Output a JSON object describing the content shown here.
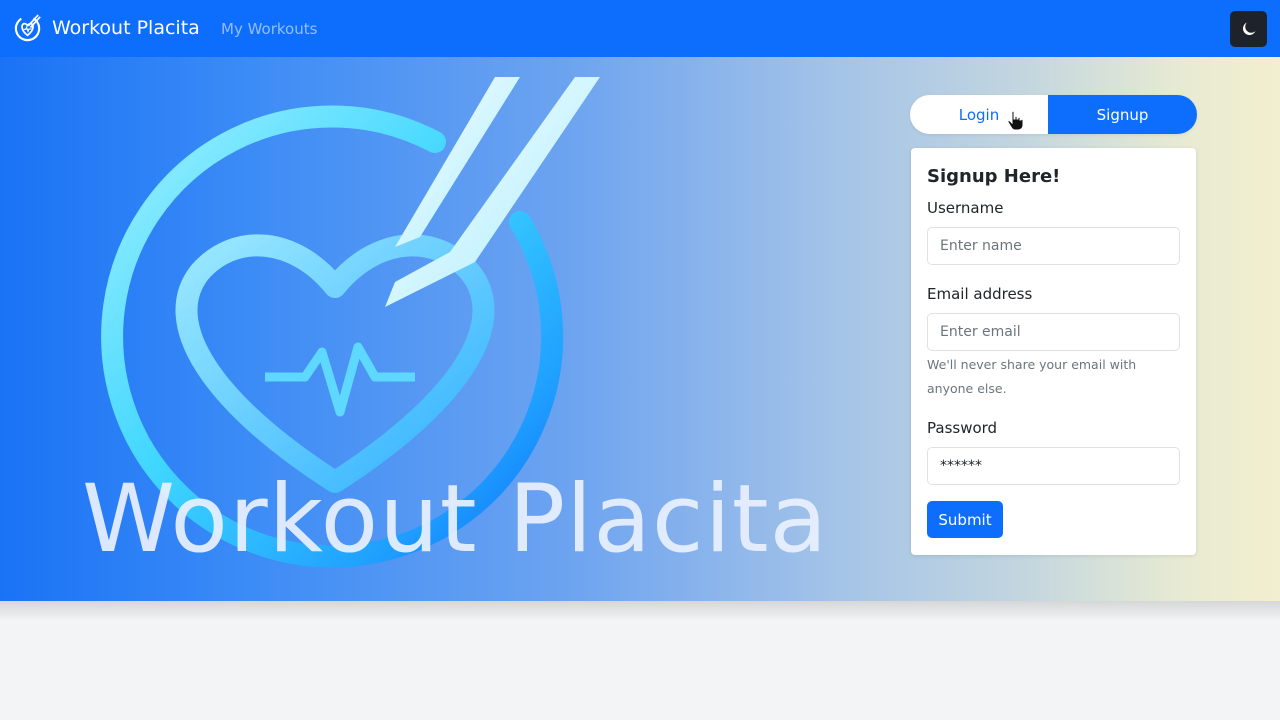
{
  "navbar": {
    "brand_name": "Workout Placita",
    "nav_link": "My Workouts",
    "theme_toggle_icon": "moon-icon"
  },
  "hero": {
    "title": "Workout Placita",
    "logo_icon": "heart-pulse-logo-icon"
  },
  "auth_tabs": {
    "login_label": "Login",
    "signup_label": "Signup",
    "active": "Signup"
  },
  "signup_form": {
    "title": "Signup Here!",
    "username_label": "Username",
    "username_placeholder": "Enter name",
    "email_label": "Email address",
    "email_placeholder": "Enter email",
    "email_help": "We'll never share your email with anyone else.",
    "password_label": "Password",
    "password_value": "******",
    "submit_label": "Submit"
  },
  "colors": {
    "primary": "#0d6efd",
    "toggle_bg": "#1e232b"
  }
}
